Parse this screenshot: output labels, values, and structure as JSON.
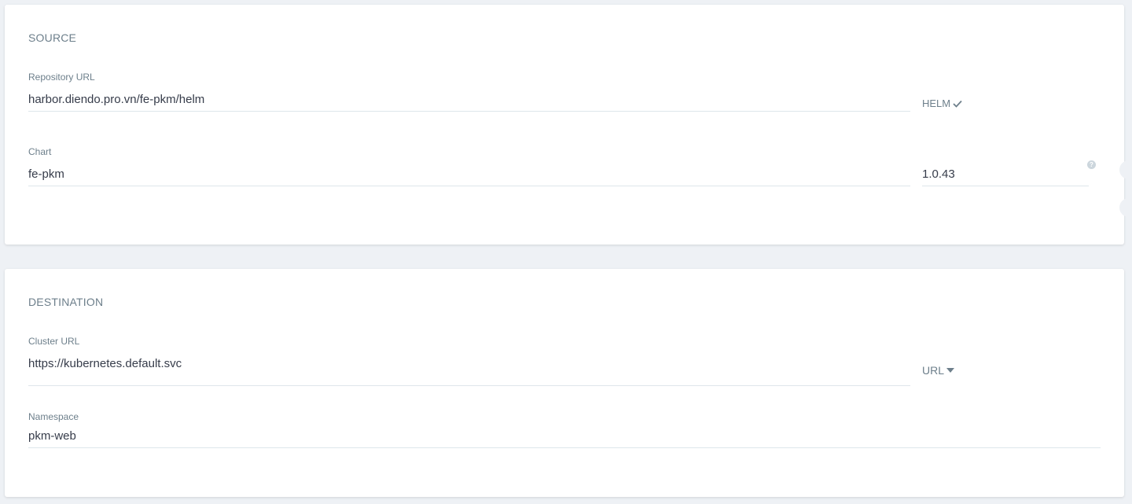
{
  "source": {
    "title": "SOURCE",
    "repo_url": {
      "label": "Repository URL",
      "value": "harbor.diendo.pro.vn/fe-pkm/helm",
      "type_label": "HELM",
      "type_icon": "check-icon"
    },
    "chart": {
      "label": "Chart",
      "value": "fe-pkm",
      "version": "1.0.43",
      "help_icon": "help-circle-icon"
    }
  },
  "destination": {
    "title": "DESTINATION",
    "cluster_url": {
      "label": "Cluster URL",
      "value": "https://kubernetes.default.svc",
      "type_label": "URL",
      "type_icon": "caret-down-icon"
    },
    "namespace": {
      "label": "Namespace",
      "value": "pkm-web"
    }
  },
  "colors": {
    "background": "#eef1f5",
    "card": "#ffffff",
    "label": "#6d7f8b",
    "text": "#363c4a",
    "border": "#dee6eb"
  }
}
